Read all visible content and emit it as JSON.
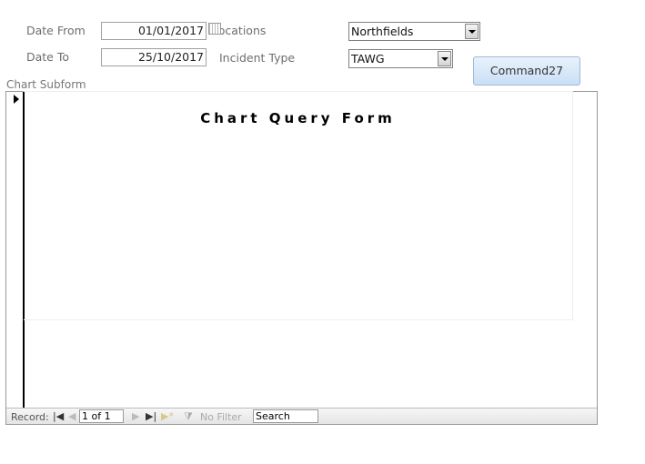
{
  "filters": {
    "date_from_label": "Date From",
    "date_from_value": "01/01/2017",
    "date_to_label": "Date To",
    "date_to_value": "25/10/2017",
    "locations_label": "Locations",
    "locations_value": "Northfields",
    "incident_type_label": "Incident Type",
    "incident_type_value": "TAWG",
    "command_label": "Command27"
  },
  "subform": {
    "label": "Chart Subform",
    "title": "Chart Query Form"
  },
  "navbar": {
    "record_label": "Record:",
    "record_value": "1 of 1",
    "filter_label": "No Filter",
    "search_value": "Search"
  }
}
